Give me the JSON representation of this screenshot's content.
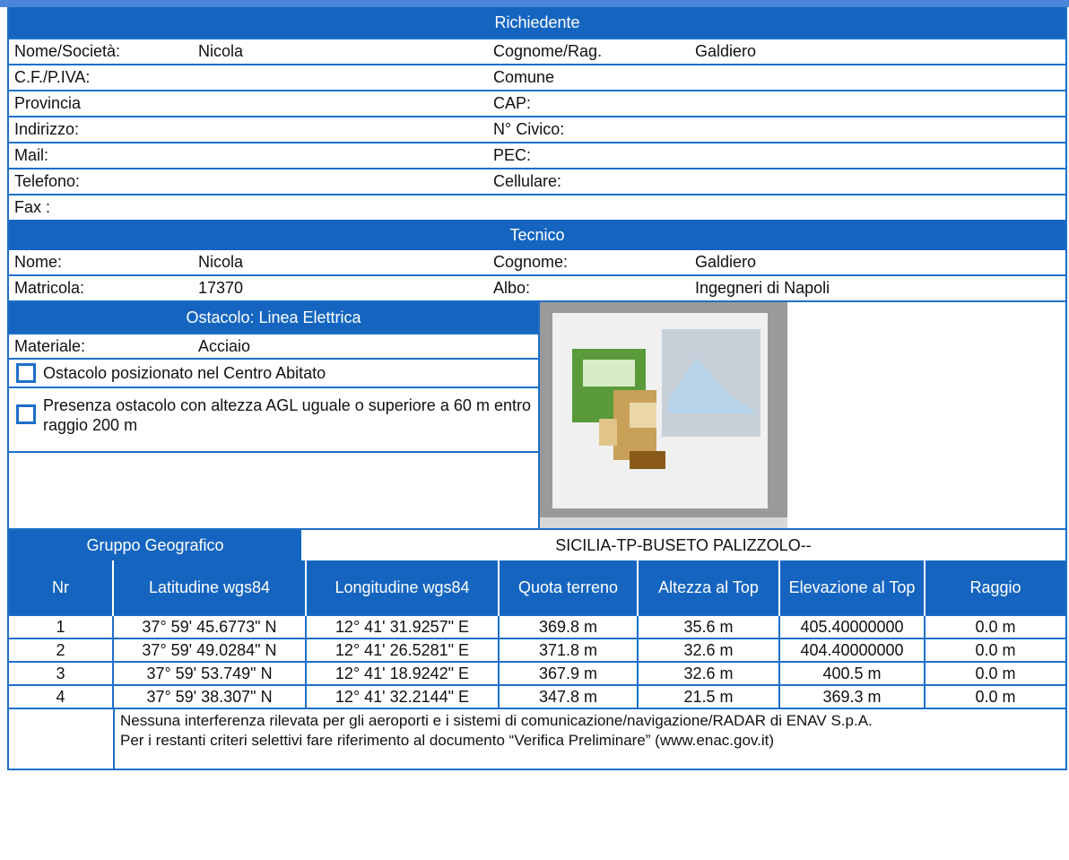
{
  "richiedente": {
    "header": "Richiedente",
    "rows": [
      {
        "l1": "Nome/Società:",
        "v1": "Nicola",
        "l2": "Cognome/Rag.",
        "v2": "Galdiero"
      },
      {
        "l1": "C.F./P.IVA:",
        "v1": "",
        "l2": "Comune",
        "v2": ""
      },
      {
        "l1": "Provincia",
        "v1": "",
        "l2": "CAP:",
        "v2": ""
      },
      {
        "l1": "Indirizzo:",
        "v1": "",
        "l2": "N° Civico:",
        "v2": ""
      },
      {
        "l1": "Mail:",
        "v1": "",
        "l2": "PEC:",
        "v2": ""
      },
      {
        "l1": "Telefono:",
        "v1": "",
        "l2": "Cellulare:",
        "v2": ""
      },
      {
        "l1": "Fax :",
        "v1": "",
        "l2": "",
        "v2": ""
      }
    ]
  },
  "tecnico": {
    "header": "Tecnico",
    "rows": [
      {
        "l1": "Nome:",
        "v1": "Nicola",
        "l2": "Cognome:",
        "v2": "Galdiero"
      },
      {
        "l1": "Matricola:",
        "v1": "17370",
        "l2": "Albo:",
        "v2": "Ingegneri di Napoli"
      }
    ]
  },
  "ostacolo": {
    "header": "Ostacolo: Linea Elettrica",
    "materiale_label": "Materiale:",
    "materiale_value": "Acciaio",
    "check1": "Ostacolo posizionato nel Centro Abitato",
    "check2": "Presenza ostacolo con altezza AGL uguale o superiore a 60 m entro raggio 200 m"
  },
  "geo": {
    "label": "Gruppo Geografico",
    "value": "SICILIA-TP-BUSETO PALIZZOLO--"
  },
  "table": {
    "headers": [
      "Nr",
      "Latitudine wgs84",
      "Longitudine wgs84",
      "Quota terreno",
      "Altezza al Top",
      "Elevazione al Top",
      "Raggio"
    ],
    "rows": [
      [
        "1",
        "37° 59' 45.6773\" N",
        "12° 41' 31.9257\" E",
        "369.8 m",
        "35.6 m",
        "405.40000000",
        "0.0 m"
      ],
      [
        "2",
        "37° 59' 49.0284\" N",
        "12° 41' 26.5281\" E",
        "371.8 m",
        "32.6 m",
        "404.40000000",
        "0.0 m"
      ],
      [
        "3",
        "37° 59' 53.749\" N",
        "12° 41' 18.9242\" E",
        "367.9 m",
        "32.6 m",
        "400.5 m",
        "0.0 m"
      ],
      [
        "4",
        "37° 59' 38.307\" N",
        "12° 41' 32.2144\" E",
        "347.8 m",
        "21.5 m",
        "369.3 m",
        "0.0 m"
      ]
    ]
  },
  "note": {
    "line1": "Nessuna interferenza rilevata per gli aeroporti e i sistemi di comunicazione/navigazione/RADAR di ENAV S.p.A.",
    "line2": "Per i restanti criteri selettivi fare riferimento al documento “Verifica Preliminare”  (www.enac.gov.it)"
  }
}
